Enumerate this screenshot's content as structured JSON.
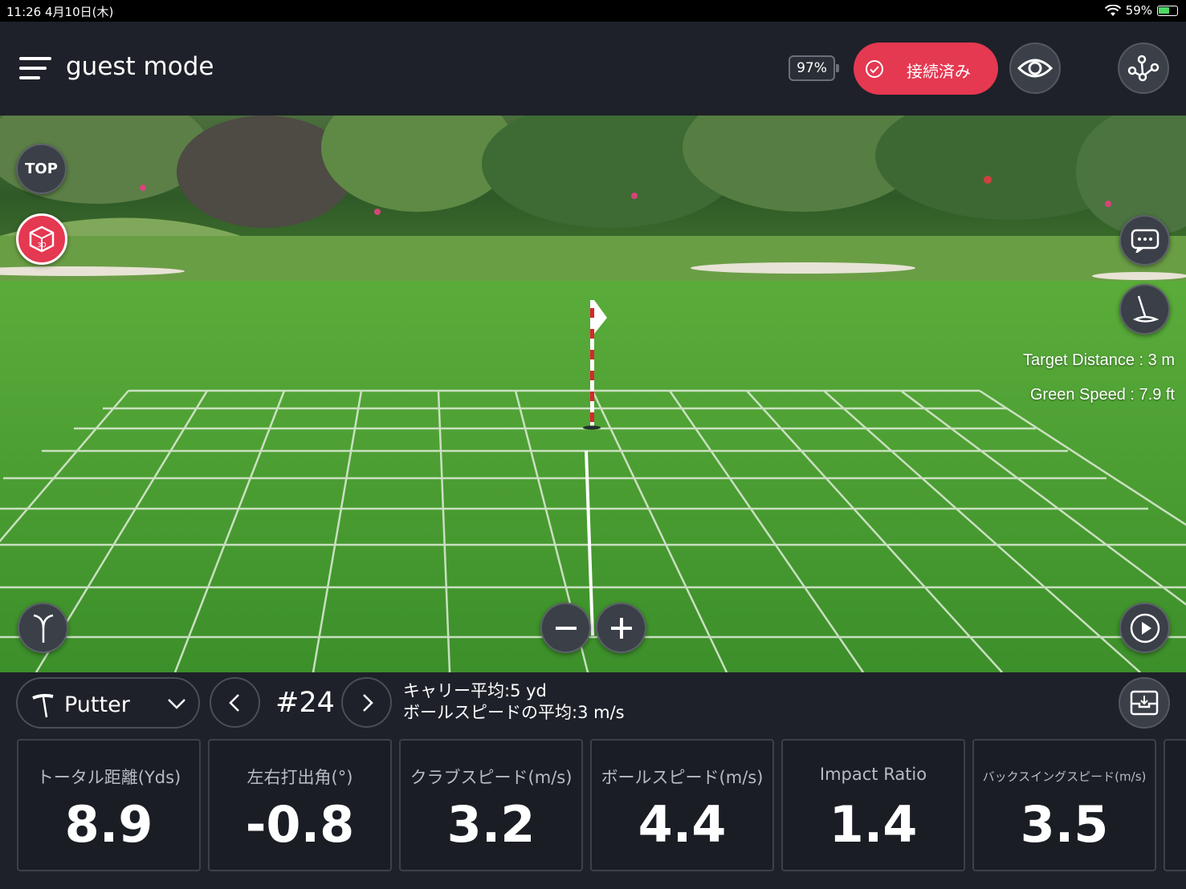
{
  "status_bar": {
    "time_date": "11:26   4月10日(木)",
    "battery_text": "59%"
  },
  "header": {
    "title": "guest mode",
    "device_battery": "97%",
    "connect_label": "接続済み",
    "icons": [
      "menu-icon",
      "check-circle-icon",
      "eye-icon",
      "route-icon"
    ]
  },
  "scene": {
    "top_label": "TOP",
    "view_3d_label": "3D",
    "target_distance": "Target Distance : 3 m",
    "green_speed": "Green Speed : 7.9 ft",
    "icons": [
      "chat-icon",
      "putter-icon",
      "trajectory-icon",
      "zoom-out-icon",
      "zoom-in-icon",
      "play-icon"
    ]
  },
  "control": {
    "club": "Putter",
    "shot_number": "#24",
    "carry_avg": "キャリー平均:5 yd",
    "ball_speed_avg": "ボールスピードの平均:3 m/s"
  },
  "metrics": [
    {
      "label": "トータル距離(Yds)",
      "value": "8.9"
    },
    {
      "label": "左右打出角(°)",
      "value": "-0.8"
    },
    {
      "label": "クラブスピード(m/s)",
      "value": "3.2"
    },
    {
      "label": "ボールスピード(m/s)",
      "value": "4.4"
    },
    {
      "label": "Impact Ratio",
      "value": "1.4"
    },
    {
      "label": "バックスイングスピード(m/s)",
      "value": "3.5"
    }
  ],
  "colors": {
    "accent": "#e53851",
    "background": "#1e2129",
    "green": "#4a9a33"
  }
}
